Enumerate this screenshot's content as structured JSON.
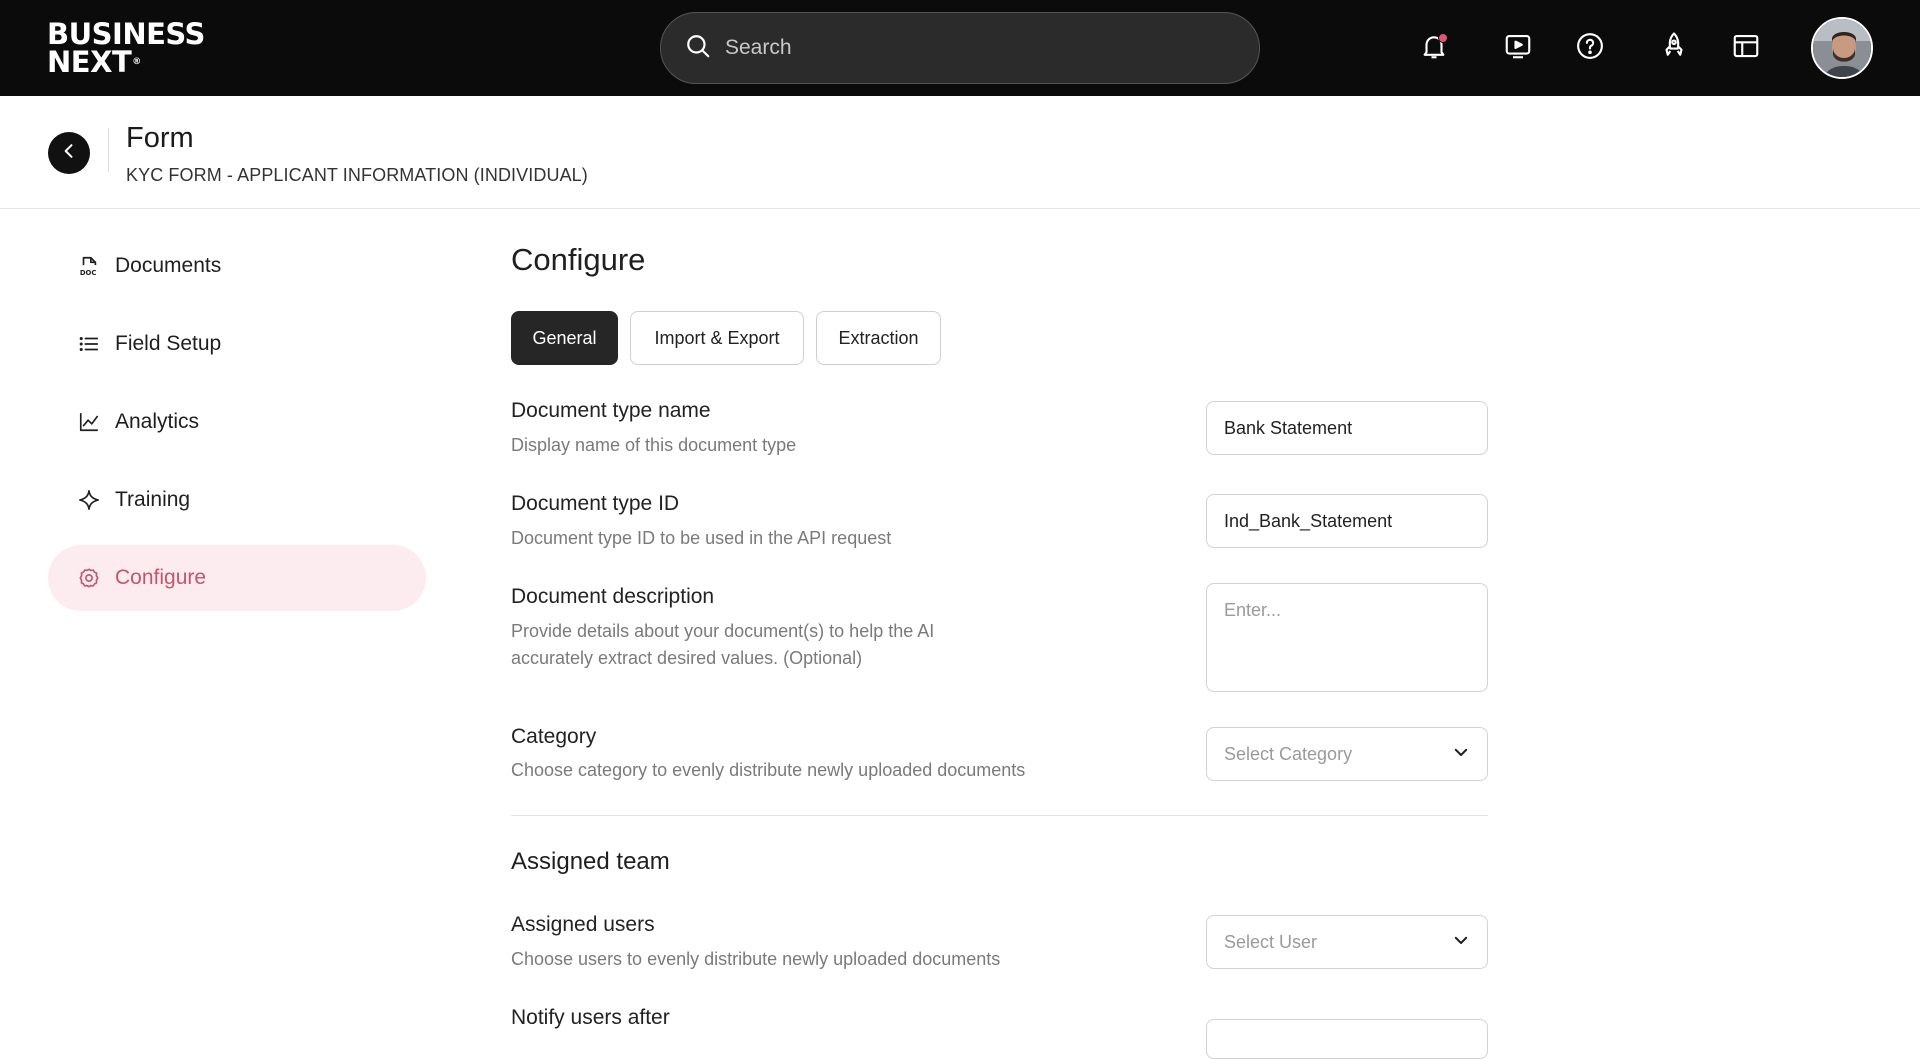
{
  "topbar": {
    "logo_line1": "BUSINESS",
    "logo_line2": "NEXT",
    "logo_mark": "®",
    "search_placeholder": "Search",
    "icons": [
      "bell-icon",
      "video-play-icon",
      "help-icon",
      "rocket-icon",
      "layout-icon"
    ],
    "notification_dot_color": "#e05670"
  },
  "header": {
    "title": "Form",
    "subtitle": "KYC FORM - APPLICANT INFORMATION (INDIVIDUAL)"
  },
  "sidebar": {
    "items": [
      {
        "label": "Documents",
        "icon": "document-icon",
        "active": false
      },
      {
        "label": "Field Setup",
        "icon": "list-icon",
        "active": false
      },
      {
        "label": "Analytics",
        "icon": "chart-icon",
        "active": false
      },
      {
        "label": "Training",
        "icon": "sparkle-icon",
        "active": false
      },
      {
        "label": "Configure",
        "icon": "gear-icon",
        "active": true
      }
    ],
    "active_color": "#c4566b",
    "active_bg": "#fcecf0"
  },
  "main": {
    "title": "Configure",
    "tabs": [
      {
        "label": "General",
        "active": true
      },
      {
        "label": "Import & Export",
        "active": false
      },
      {
        "label": "Extraction",
        "active": false
      }
    ],
    "fields": {
      "doc_type_name": {
        "label": "Document type name",
        "description": "Display name of this document type",
        "value": "Bank Statement"
      },
      "doc_type_id": {
        "label": "Document type ID",
        "description": "Document type ID to be used in the API request",
        "value": "Ind_Bank_Statement"
      },
      "doc_description": {
        "label": "Document description",
        "description_line1": "Provide details about your document(s) to help the AI",
        "description_line2": "accurately extract desired values. (Optional)",
        "placeholder": "Enter..."
      },
      "category": {
        "label": "Category",
        "description": "Choose category to evenly distribute newly uploaded documents",
        "placeholder": "Select Category"
      }
    },
    "assigned_team": {
      "title": "Assigned team",
      "assigned_users": {
        "label": "Assigned users",
        "description": "Choose users to evenly distribute newly uploaded documents",
        "placeholder": "Select User"
      },
      "notify_users": {
        "label": "Notify users after"
      }
    }
  }
}
